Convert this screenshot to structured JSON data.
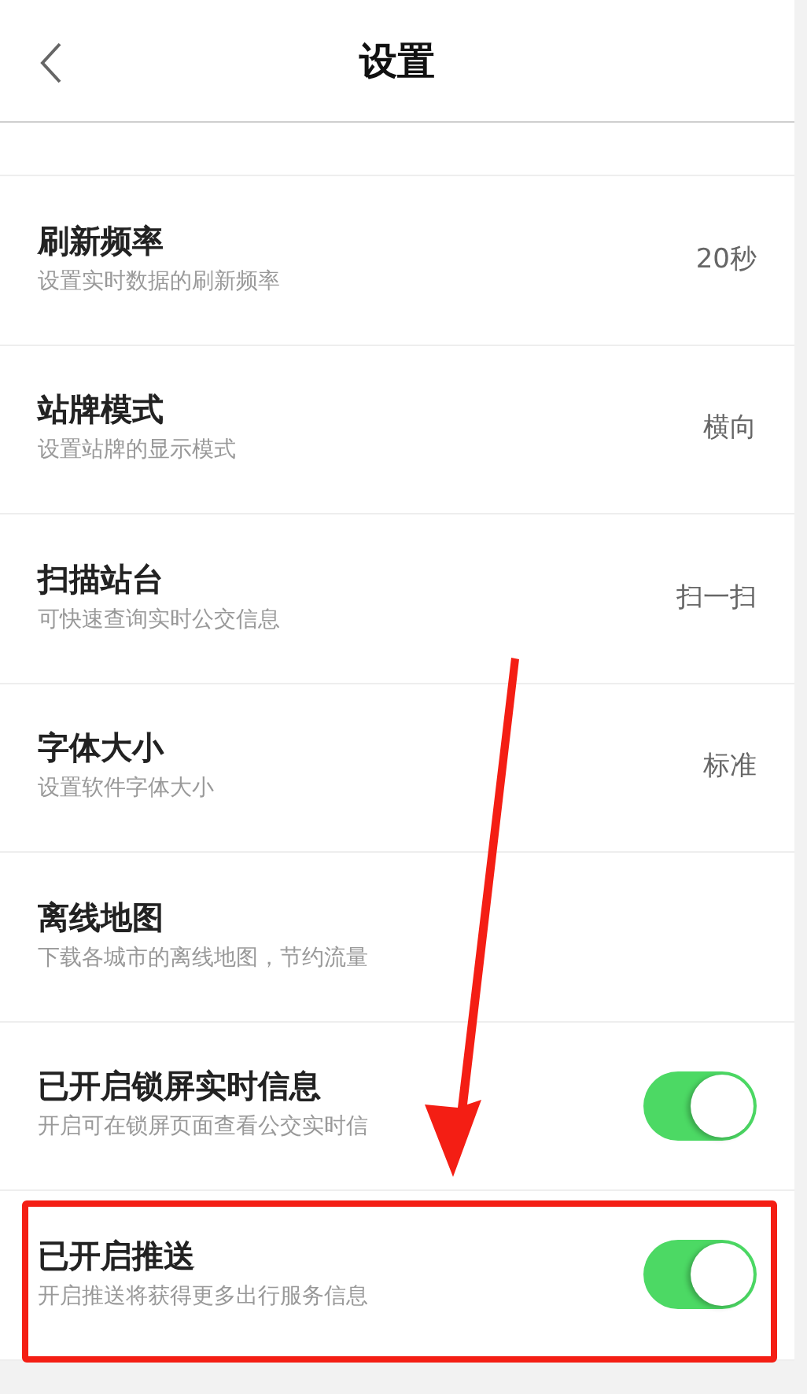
{
  "header": {
    "title": "设置"
  },
  "settings": [
    {
      "kind": "value",
      "title": "刷新频率",
      "subtitle": "设置实时数据的刷新频率",
      "value": "20秒"
    },
    {
      "kind": "value",
      "title": "站牌模式",
      "subtitle": "设置站牌的显示模式",
      "value": "横向"
    },
    {
      "kind": "value",
      "title": "扫描站台",
      "subtitle": "可快速查询实时公交信息",
      "value": "扫一扫"
    },
    {
      "kind": "value",
      "title": "字体大小",
      "subtitle": "设置软件字体大小",
      "value": "标准"
    },
    {
      "kind": "link",
      "title": "离线地图",
      "subtitle": "下载各城市的离线地图，节约流量"
    },
    {
      "kind": "toggle",
      "title": "已开启锁屏实时信息",
      "subtitle": "开启可在锁屏页面查看公交实时信",
      "on": true
    },
    {
      "kind": "toggle",
      "title": "已开启推送",
      "subtitle": "开启推送将获得更多出行服务信息",
      "on": true
    }
  ]
}
